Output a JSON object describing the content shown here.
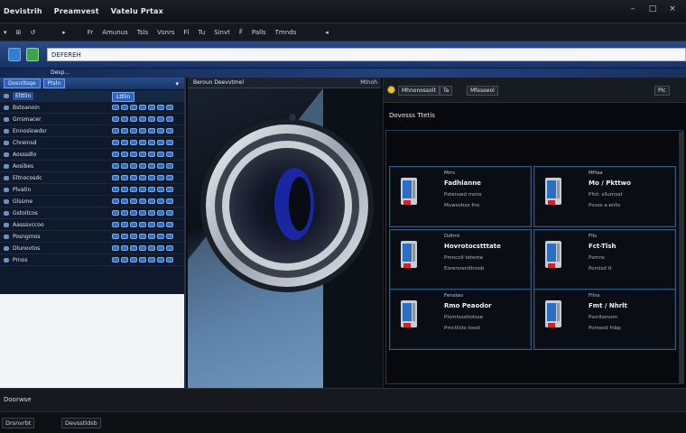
{
  "window": {
    "title_parts": [
      "Devistrih",
      "Preamvest",
      "Vatelu Prtax"
    ],
    "controls": [
      "–",
      "□",
      "×"
    ]
  },
  "menu": {
    "items": [
      "▾",
      "⊞",
      "↺",
      "▸",
      "Fr",
      "Amunus",
      "Tsls",
      "Vsnrs",
      "Fl",
      "Tu",
      "Sinvt",
      "F̈",
      "Palls",
      "Tmnds",
      "◂"
    ]
  },
  "toolbar": {
    "address_value": "DEFEREH"
  },
  "strip": {
    "label": "Desp..."
  },
  "left_panel": {
    "header_tabs": [
      "Dosnttsqe",
      "Ptsln"
    ],
    "column_header": "Lttlin",
    "name_header": "Elttlin",
    "rows": [
      "Bstoanoin",
      "Grrsmacer",
      "Ennoslowdsr",
      "Chreinsd",
      "Aosssdlo",
      "Aosibes",
      "Eltnocosdc",
      "Plvatin",
      "Glssme",
      "Gstoitcos",
      "Aasssvccoo",
      "Posngmos",
      "Dlunovtos",
      "Prnos"
    ]
  },
  "center_panel": {
    "header": "Beroun Deevvtmel",
    "header_right": "Mtnoh"
  },
  "right_panel": {
    "head_buttons": [
      "Mhnonossolt",
      "Ta",
      "Mfeseeol",
      "Plc"
    ],
    "section_title": "Dovesss Ttetis",
    "cards": [
      {
        "head": "Mrrs",
        "title": "Fadhlanne",
        "sub": "Pstensed mons",
        "sub2": "Muwsvbos fno"
      },
      {
        "head": "MHaa",
        "title": "Mo / Pkttwo",
        "sub": "Pfnt: sllumsat",
        "sub2": "Psvos a enlis"
      },
      {
        "head": "Ddtmt",
        "title": "Hovrotocstttate",
        "sub": "Pmncoll teteme",
        "sub2": "Eorennenlttroob"
      },
      {
        "head": "Flls",
        "title": "Fct-Tlsh",
        "sub": "Psmns",
        "sub2": "Pomlsd tt"
      },
      {
        "head": "Fenstes",
        "title": "Rmo Peaodor",
        "sub": "Plvmtsssttotsse",
        "sub2": "Pmctllsts tosst"
      },
      {
        "head": "Fllns",
        "title": "Fmt / Nhrlt",
        "sub": "Psmllomom",
        "sub2": "Pomesd fnbp"
      }
    ]
  },
  "status": {
    "left": "Doorwse",
    "bottom_items": [
      "Drsnvrbt",
      "Devsstldsb"
    ]
  },
  "colors": {
    "accent": "#2f64b8",
    "toolbar": "#2b4b86",
    "card_border": "#2d5f86",
    "radio": "#e6c23a"
  }
}
